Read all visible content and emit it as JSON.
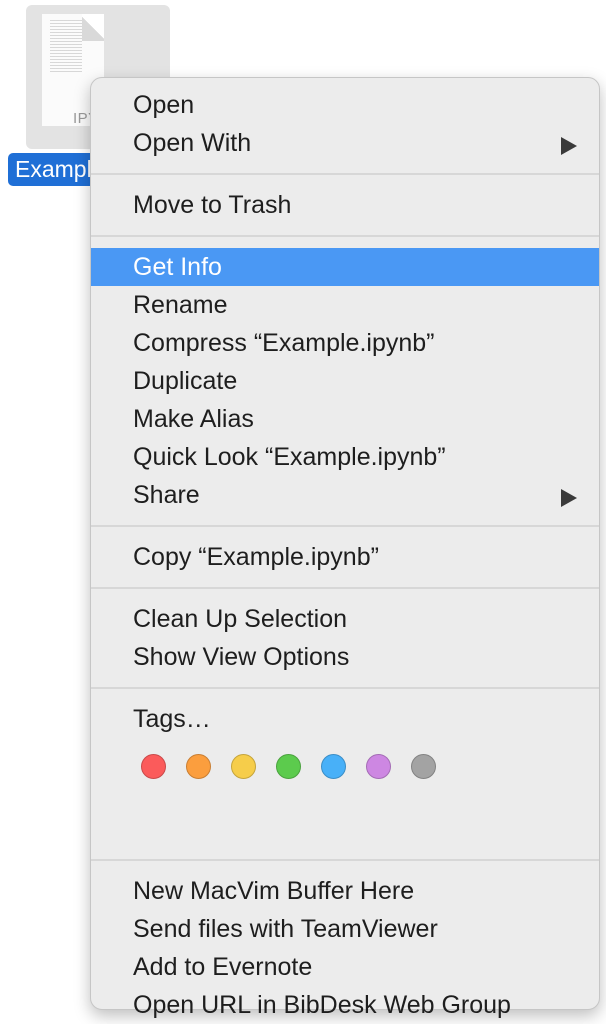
{
  "file": {
    "icon_text": "IPY",
    "label": "Example.ipynb"
  },
  "menu": {
    "group1": [
      "Open",
      "Open With"
    ],
    "group2": [
      "Move to Trash"
    ],
    "group3": [
      "Get Info",
      "Rename",
      "Compress “Example.ipynb”",
      "Duplicate",
      "Make Alias",
      "Quick Look “Example.ipynb”",
      "Share"
    ],
    "group4": [
      "Copy “Example.ipynb”"
    ],
    "group5": [
      "Clean Up Selection",
      "Show View Options"
    ],
    "tags_label": "Tags…",
    "tag_colors": [
      {
        "name": "red",
        "color": "#fb5b5b"
      },
      {
        "name": "orange",
        "color": "#fb9e3e"
      },
      {
        "name": "yellow",
        "color": "#f6cd4a"
      },
      {
        "name": "green",
        "color": "#5ccb4d"
      },
      {
        "name": "blue",
        "color": "#48b0f8"
      },
      {
        "name": "purple",
        "color": "#cd87e2"
      },
      {
        "name": "gray",
        "color": "#a3a3a3"
      }
    ],
    "group7": [
      "New MacVim Buffer Here",
      "Send files with TeamViewer",
      "Add to Evernote",
      "Open URL in BibDesk Web Group"
    ],
    "highlighted_item": "Get Info",
    "highlight_color": "#4a98f4"
  }
}
